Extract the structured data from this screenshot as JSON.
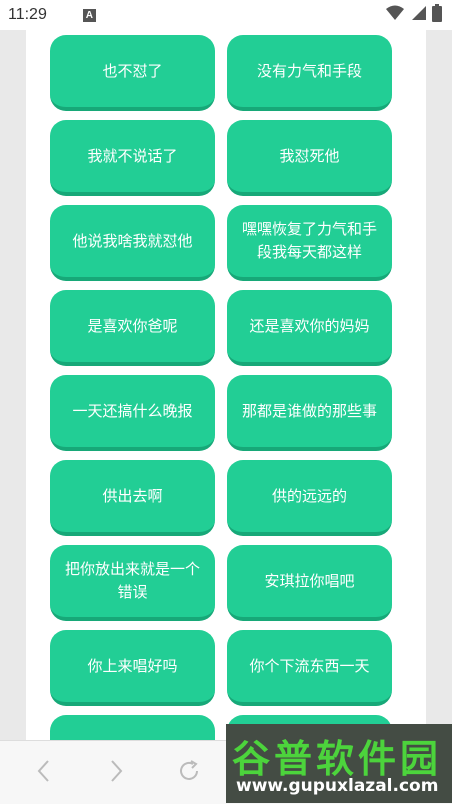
{
  "status": {
    "time": "11:29",
    "notification_icon": "A"
  },
  "icons": {
    "wifi": "wifi-icon",
    "signal": "signal-icon",
    "battery": "battery-icon",
    "back": "chevron-left-icon",
    "forward": "chevron-right-icon",
    "refresh": "refresh-icon"
  },
  "colors": {
    "button": "#22ce95",
    "button_shadow": "#17a878"
  },
  "buttons": [
    "也不怼了",
    "没有力气和手段",
    "我就不说话了",
    "我怼死他",
    "他说我啥我就怼他",
    "嘿嘿恢复了力气和手段我每天都这样",
    "是喜欢你爸呢",
    "还是喜欢你的妈妈",
    "一天还搞什么晚报",
    "那都是谁做的那些事",
    "供出去啊",
    "供的远远的",
    "把你放出来就是一个错误",
    "安琪拉你唱吧",
    "你上来唱好吗",
    "你个下流东西一天",
    "",
    ""
  ],
  "watermark": {
    "title": "谷普软件园",
    "url": "www.gupuxlazal.com"
  }
}
